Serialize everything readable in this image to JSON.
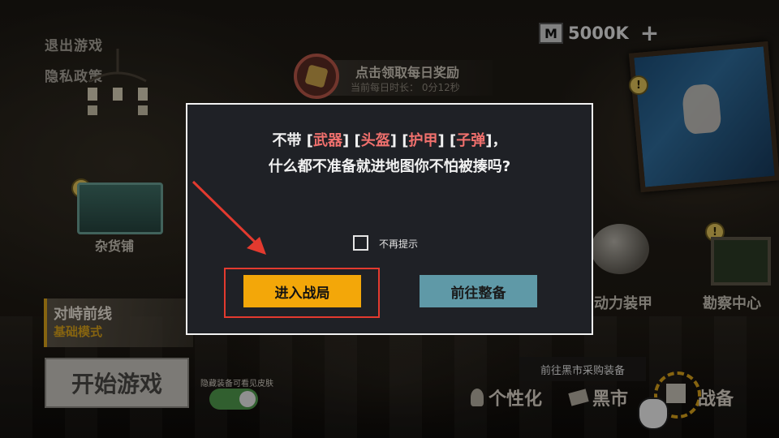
{
  "top_menu": {
    "exit_game": "退出游戏",
    "privacy_policy": "隐私政策"
  },
  "currency": {
    "icon_letter": "M",
    "amount": "5000K",
    "add_symbol": "+"
  },
  "daily_reward": {
    "title": "点击领取每日奖励",
    "subtitle": "当前每日时长：  0分12秒"
  },
  "locations": {
    "shop": "杂货铺",
    "armor": "动力装甲",
    "recon": "勘察中心"
  },
  "mode": {
    "title": "对峙前线",
    "subtitle": "基础模式"
  },
  "start_button": "开始游戏",
  "skin_toggle": {
    "label": "隐藏装备可看见皮肤",
    "on": true
  },
  "bottom_nav": {
    "tooltip": "前往黑市采购装备",
    "items": [
      "个性化",
      "黑市",
      "战备"
    ]
  },
  "dialog": {
    "line1_prefix": "不带 ",
    "item1": "武器",
    "item2": "头盔",
    "item3": "护甲",
    "item4": "子弹",
    "line1_suffix": "，",
    "line2": "什么都不准备就进地图你不怕被揍吗?",
    "dont_show_again": "不再提示",
    "enter_battle": "进入战局",
    "go_prepare": "前往整备"
  },
  "colors": {
    "accent_orange": "#f3a709",
    "accent_teal": "#5f99a7",
    "highlight_red": "#e33a2f",
    "item_red": "#f0706d"
  }
}
